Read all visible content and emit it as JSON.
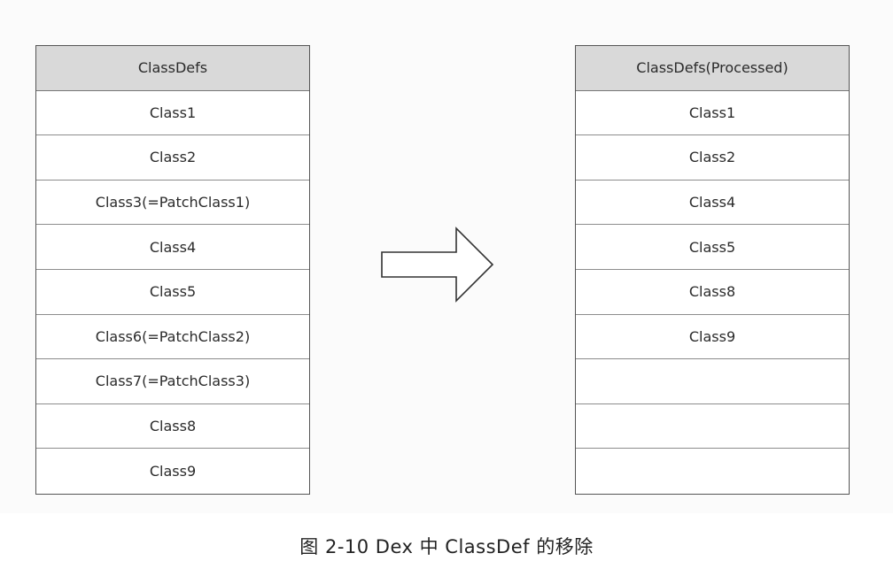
{
  "left_table": {
    "header": "ClassDefs",
    "rows": [
      "Class1",
      "Class2",
      "Class3(=PatchClass1)",
      "Class4",
      "Class5",
      "Class6(=PatchClass2)",
      "Class7(=PatchClass3)",
      "Class8",
      "Class9"
    ]
  },
  "right_table": {
    "header": "ClassDefs(Processed)",
    "rows": [
      "Class1",
      "Class2",
      "Class4",
      "Class5",
      "Class8",
      "Class9",
      "",
      "",
      ""
    ]
  },
  "arrow": {
    "icon": "right-arrow-icon"
  },
  "caption": "图 2-10   Dex 中 ClassDef 的移除"
}
